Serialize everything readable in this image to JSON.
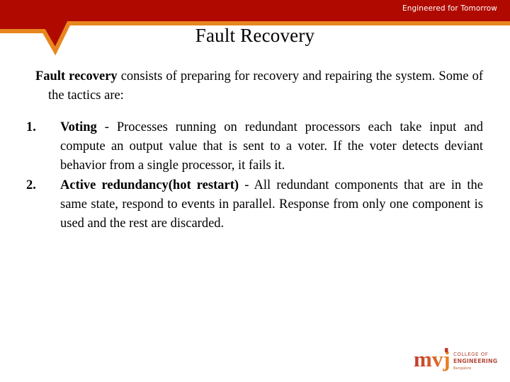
{
  "header": {
    "tagline": "Engineered for Tomorrow",
    "title": "Fault Recovery",
    "band_color": "#b00a00",
    "accent_color": "#e8861e"
  },
  "body": {
    "intro_lead": "Fault recovery",
    "intro_rest": " consists of preparing for recovery and repairing the  system. Some of the tactics are:",
    "tactics": [
      {
        "number": "1.",
        "term": "Voting",
        "text": " - Processes running on redundant processors each take input and compute an output value that is sent to a voter. If the voter detects deviant behavior from a single processor, it fails it."
      },
      {
        "number": "2.",
        "term": "Active redundancy(hot restart)",
        "text": " - All redundant components that are in the same state, respond to events in parallel. Response from only one component is used and the rest are discarded."
      }
    ]
  },
  "footer": {
    "logo_wordmark": "mvj",
    "logo_line1": "COLLEGE  OF",
    "logo_line2": "ENGINEERING",
    "logo_line3": "Bangalore",
    "logo_red": "#c0392b",
    "logo_orange": "#e8861e"
  }
}
